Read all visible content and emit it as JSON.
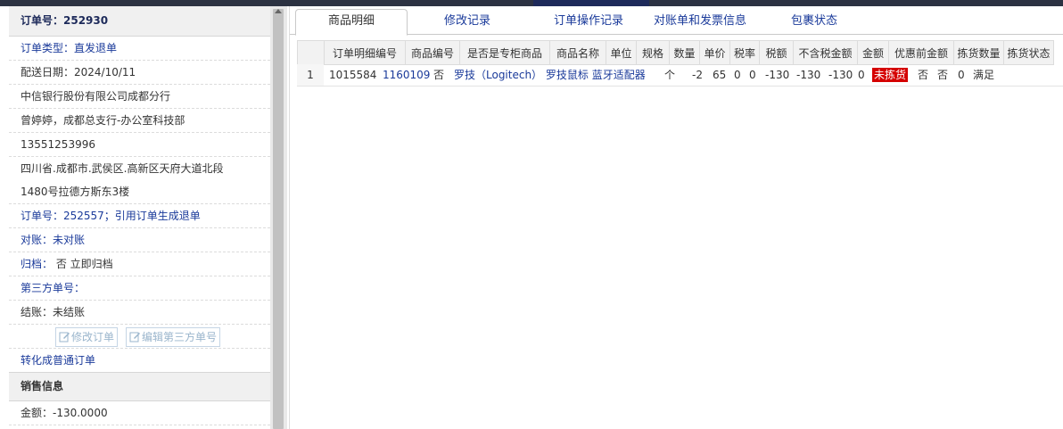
{
  "left": {
    "order_no": "订单号：252930",
    "order_type": "订单类型：直发退单",
    "delivery_date": "配送日期：2024/10/11",
    "company": "中信银行股份有限公司成都分行",
    "contact": "曾婷婷，成都总支行-办公室科技部",
    "phone": "13551253996",
    "address_line1": "四川省.成都市.武侯区.高新区天府大道北段",
    "address_line2": "1480号拉德方斯东3楼",
    "ref_order": "订单号：252557；引用订单生成退单",
    "reconcile": "对账：未对账",
    "archive_prefix": "归档：",
    "archive_value": " 否 立即归档",
    "third_party": "第三方单号：",
    "settle": "结账：未结账",
    "edit_order_btn": "修改订单",
    "edit_third_btn": "编辑第三方单号",
    "convert_link": "转化成普通订单",
    "sales_section": "销售信息",
    "amount": "金额：-130.0000"
  },
  "tabs": [
    "商品明细",
    "修改记录",
    "订单操作记录",
    "对账单和发票信息",
    "包裹状态"
  ],
  "table": {
    "headers": [
      "",
      "订单明细编号",
      "商品编号",
      "是否是专柜商品",
      "商品名称",
      "单位",
      "规格",
      "数量",
      "单价",
      "税率",
      "税额",
      "不含税金额",
      "金额",
      "优惠前金额",
      "拣货数量",
      "拣货状态"
    ],
    "row": {
      "rn": "1",
      "detail_no": "1015584",
      "product_no": "1160109",
      "counter": "否",
      "name": "罗技（Logitech） 罗技鼠标 蓝牙适配器",
      "unit": "个",
      "spec": "",
      "qty": "-2",
      "price": "65",
      "rate1": "0",
      "rate2": "0",
      "tax": "-130",
      "no_tax_amount": "-130",
      "amount": "-130",
      "pre_discount": "0",
      "pick_status": "未拣货",
      "c1": "否",
      "c2": "否",
      "c3": "0",
      "c4": "满足"
    }
  },
  "colors": {
    "accent": "#1a3a9a",
    "status_red": "#d50000",
    "topbar": "#2c3242"
  }
}
